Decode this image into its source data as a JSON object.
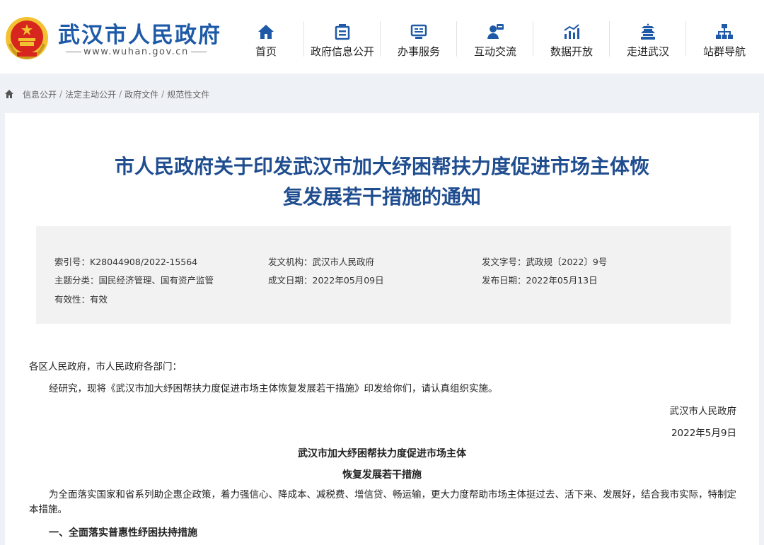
{
  "header": {
    "site_title": "武汉市人民政府",
    "site_url": "www.wuhan.gov.cn",
    "nav": [
      {
        "label": "首页",
        "icon": "home-icon"
      },
      {
        "label": "政府信息公开",
        "icon": "info-open-icon"
      },
      {
        "label": "办事服务",
        "icon": "service-icon"
      },
      {
        "label": "互动交流",
        "icon": "interaction-icon"
      },
      {
        "label": "数据开放",
        "icon": "data-chart-icon"
      },
      {
        "label": "走进武汉",
        "icon": "landmark-icon"
      },
      {
        "label": "站群导航",
        "icon": "sitemap-icon"
      }
    ]
  },
  "breadcrumb": [
    "信息公开",
    "法定主动公开",
    "政府文件",
    "规范性文件"
  ],
  "document": {
    "title_line1": "市人民政府关于印发武汉市加大纾困帮扶力度促进市场主体恢",
    "title_line2": "复发展若干措施的通知",
    "meta": {
      "index_no_label": "索引号：",
      "index_no": "K28044908/2022-15564",
      "issuer_label": "发文机构：",
      "issuer": "武汉市人民政府",
      "doc_no_label": "发文字号：",
      "doc_no": "武政规〔2022〕9号",
      "topic_label": "主题分类：",
      "topic": "国民经济管理、国有资产监管",
      "created_label": "成文日期：",
      "created": "2022年05月09日",
      "published_label": "发布日期：",
      "published": "2022年05月13日",
      "validity_label": "有效性：",
      "validity": "有效"
    },
    "salutation": "各区人民政府，市人民政府各部门：",
    "intro": "经研究，现将《武汉市加大纾困帮扶力度促进市场主体恢复发展若干措施》印发给你们，请认真组织实施。",
    "signer": "武汉市人民政府",
    "date": "2022年5月9日",
    "sub_title_1": "武汉市加大纾困帮扶力度促进市场主体",
    "sub_title_2": "恢复发展若干措施",
    "paragraph_1": "为全面落实国家和省系列助企惠企政策，着力强信心、降成本、减税费、增信贷、畅运输，更大力度帮助市场主体挺过去、活下来、发展好，结合我市实际，特制定本措施。",
    "section_1": "一、全面落实普惠性纾困扶持措施"
  },
  "colors": {
    "brand_blue": "#1e5aa8",
    "title_blue": "#1f4d8f",
    "emblem_red": "#d7261e",
    "emblem_gold": "#f2c230"
  }
}
